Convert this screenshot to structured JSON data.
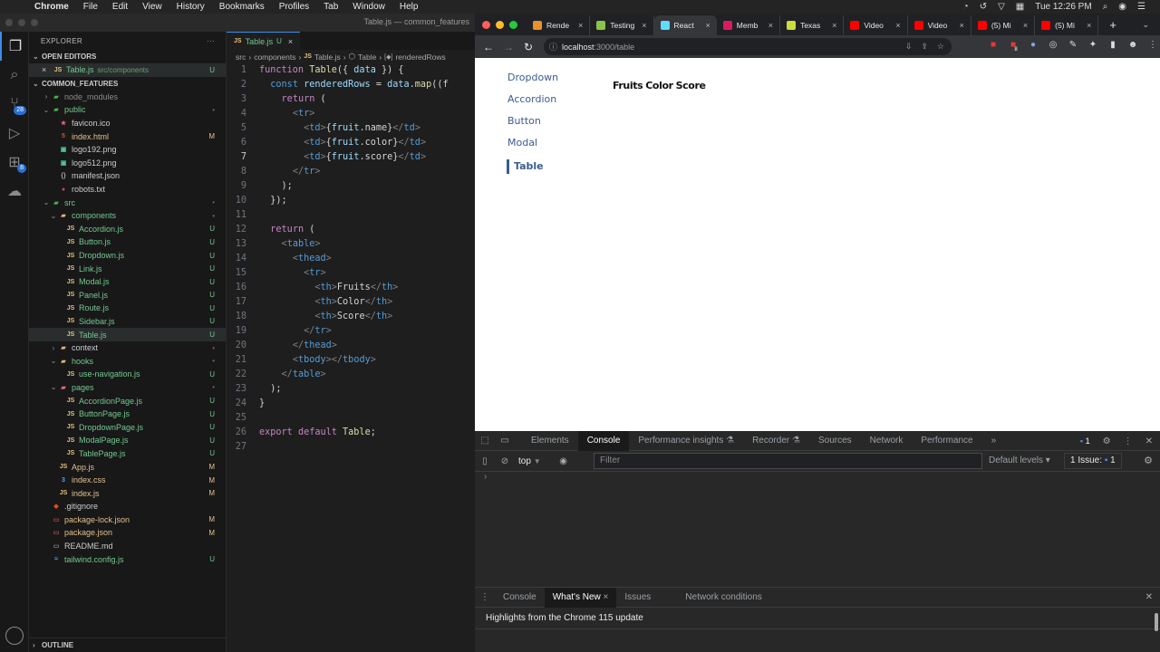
{
  "menubar": {
    "app": "Chrome",
    "items": [
      "File",
      "Edit",
      "View",
      "History",
      "Bookmarks",
      "Profiles",
      "Tab",
      "Window",
      "Help"
    ],
    "clock": "Tue 12:26 PM"
  },
  "vscode": {
    "window_title": "Table.js — common_features",
    "activity_badges": {
      "source_control": "28",
      "extensions": "8"
    },
    "explorer_label": "EXPLORER",
    "open_editors_label": "OPEN EDITORS",
    "open_editor": {
      "name": "Table.js",
      "path": "src/components",
      "status": "U"
    },
    "project_label": "COMMON_FEATURES",
    "outline_label": "OUTLINE",
    "tree": [
      {
        "name": "node_modules",
        "type": "folder",
        "depth": 0,
        "open": false,
        "color": "dim",
        "status": ""
      },
      {
        "name": "public",
        "type": "folder",
        "depth": 0,
        "open": true,
        "color": "green",
        "status": "•"
      },
      {
        "name": "favicon.ico",
        "type": "file",
        "icon": "★",
        "iconColor": "#e06c75",
        "depth": 1,
        "color": "",
        "status": ""
      },
      {
        "name": "index.html",
        "type": "file",
        "icon": "5",
        "iconColor": "#e44d26",
        "depth": 1,
        "color": "yellow",
        "status": "M"
      },
      {
        "name": "logo192.png",
        "type": "file",
        "icon": "▣",
        "iconColor": "#4ec9b0",
        "depth": 1,
        "color": "",
        "status": ""
      },
      {
        "name": "logo512.png",
        "type": "file",
        "icon": "▣",
        "iconColor": "#4ec9b0",
        "depth": 1,
        "color": "",
        "status": ""
      },
      {
        "name": "manifest.json",
        "type": "file",
        "icon": "{}",
        "iconColor": "#aaa",
        "depth": 1,
        "color": "",
        "status": ""
      },
      {
        "name": "robots.txt",
        "type": "file",
        "icon": "●",
        "iconColor": "#c74b4b",
        "depth": 1,
        "color": "",
        "status": ""
      },
      {
        "name": "src",
        "type": "folder",
        "depth": 0,
        "open": true,
        "color": "green",
        "status": "•"
      },
      {
        "name": "components",
        "type": "folder",
        "depth": 1,
        "open": true,
        "color": "green",
        "status": "•"
      },
      {
        "name": "Accordion.js",
        "type": "js",
        "depth": 2,
        "color": "green",
        "status": "U"
      },
      {
        "name": "Button.js",
        "type": "js",
        "depth": 2,
        "color": "green",
        "status": "U"
      },
      {
        "name": "Dropdown.js",
        "type": "js",
        "depth": 2,
        "color": "green",
        "status": "U"
      },
      {
        "name": "Link.js",
        "type": "js",
        "depth": 2,
        "color": "green",
        "status": "U"
      },
      {
        "name": "Modal.js",
        "type": "js",
        "depth": 2,
        "color": "green",
        "status": "U"
      },
      {
        "name": "Panel.js",
        "type": "js",
        "depth": 2,
        "color": "green",
        "status": "U"
      },
      {
        "name": "Route.js",
        "type": "js",
        "depth": 2,
        "color": "green",
        "status": "U"
      },
      {
        "name": "Sidebar.js",
        "type": "js",
        "depth": 2,
        "color": "green",
        "status": "U"
      },
      {
        "name": "Table.js",
        "type": "js",
        "depth": 2,
        "color": "green",
        "status": "U",
        "selected": true
      },
      {
        "name": "context",
        "type": "folder",
        "depth": 1,
        "open": false,
        "color": "",
        "status": "•"
      },
      {
        "name": "hooks",
        "type": "folder",
        "depth": 1,
        "open": true,
        "color": "green",
        "status": "•"
      },
      {
        "name": "use-navigation.js",
        "type": "js",
        "depth": 2,
        "color": "green",
        "status": "U"
      },
      {
        "name": "pages",
        "type": "folder",
        "depth": 1,
        "open": true,
        "color": "green",
        "status": "•"
      },
      {
        "name": "AccordionPage.js",
        "type": "js",
        "depth": 2,
        "color": "green",
        "status": "U"
      },
      {
        "name": "ButtonPage.js",
        "type": "js",
        "depth": 2,
        "color": "green",
        "status": "U"
      },
      {
        "name": "DropdownPage.js",
        "type": "js",
        "depth": 2,
        "color": "green",
        "status": "U"
      },
      {
        "name": "ModalPage.js",
        "type": "js",
        "depth": 2,
        "color": "green",
        "status": "U"
      },
      {
        "name": "TablePage.js",
        "type": "js",
        "depth": 2,
        "color": "green",
        "status": "U"
      },
      {
        "name": "App.js",
        "type": "js",
        "depth": 1,
        "color": "yellow",
        "status": "M"
      },
      {
        "name": "index.css",
        "type": "file",
        "icon": "3",
        "iconColor": "#42a5f5",
        "depth": 1,
        "color": "yellow",
        "status": "M"
      },
      {
        "name": "index.js",
        "type": "js",
        "depth": 1,
        "color": "yellow",
        "status": "M"
      },
      {
        "name": ".gitignore",
        "type": "file",
        "icon": "◆",
        "iconColor": "#e64a19",
        "depth": 0,
        "color": "",
        "status": ""
      },
      {
        "name": "package-lock.json",
        "type": "file",
        "icon": "▭",
        "iconColor": "#c74b4b",
        "depth": 0,
        "color": "yellow",
        "status": "M"
      },
      {
        "name": "package.json",
        "type": "file",
        "icon": "▭",
        "iconColor": "#c74b4b",
        "depth": 0,
        "color": "yellow",
        "status": "M"
      },
      {
        "name": "README.md",
        "type": "file",
        "icon": "▭",
        "iconColor": "#888",
        "depth": 0,
        "color": "",
        "status": ""
      },
      {
        "name": "tailwind.config.js",
        "type": "file",
        "icon": "≈",
        "iconColor": "#38bdf8",
        "depth": 0,
        "color": "green",
        "status": "U"
      }
    ],
    "editor_tab": {
      "name": "Table.js",
      "status": "U"
    },
    "breadcrumb": [
      "src",
      "components",
      "Table.js",
      "Table",
      "renderedRows"
    ],
    "current_line": 7,
    "code_lines": [
      "function Table({ data }) {",
      "  const renderedRows = data.map((f",
      "    return (",
      "      <tr>",
      "        <td>{fruit.name}</td>",
      "        <td>{fruit.color}</td>",
      "        <td>{fruit.score}</td>",
      "      </tr>",
      "    );",
      "  });",
      "",
      "  return (",
      "    <table>",
      "      <thead>",
      "        <tr>",
      "          <th>Fruits</th>",
      "          <th>Color</th>",
      "          <th>Score</th>",
      "        </tr>",
      "      </thead>",
      "      <tbody></tbody>",
      "    </table>",
      "  );",
      "}",
      "",
      "export default Table;",
      ""
    ]
  },
  "chrome": {
    "tabs": [
      {
        "title": "Rende",
        "favColor": "#e8912d",
        "active": false
      },
      {
        "title": "Testing",
        "favColor": "#8bc34a",
        "active": false
      },
      {
        "title": "React",
        "favColor": "#61dafb",
        "active": true
      },
      {
        "title": "Memb",
        "favColor": "#d81b60",
        "active": false
      },
      {
        "title": "Texas",
        "favColor": "#cddc39",
        "active": false
      },
      {
        "title": "Video",
        "favColor": "#ff0000",
        "active": false
      },
      {
        "title": "Video",
        "favColor": "#ff0000",
        "active": false
      },
      {
        "title": "(5) Mi",
        "favColor": "#ff0000",
        "active": false
      },
      {
        "title": "(5) Mi",
        "favColor": "#ff0000",
        "active": false
      }
    ],
    "url_host": "localhost",
    "url_rest": ":3000/table",
    "extension_badge": "8",
    "page": {
      "nav": [
        "Dropdown",
        "Accordion",
        "Button",
        "Modal",
        "Table"
      ],
      "active_nav": "Table",
      "table_headers": [
        "Fruits",
        "Color",
        "Score"
      ]
    },
    "devtools": {
      "tabs": [
        "Elements",
        "Console",
        "Performance insights",
        "Recorder",
        "Sources",
        "Network",
        "Performance"
      ],
      "active_tab": "Console",
      "message_count": "1",
      "context": "top",
      "filter_placeholder": "Filter",
      "levels": "Default levels",
      "issues_label": "1 Issue:",
      "issues_count": "1",
      "prompt": "›",
      "drawer_tabs": [
        "Console",
        "What's New",
        "Issues",
        "Network conditions"
      ],
      "drawer_active": "What's New",
      "whats_new_text": "Highlights from the Chrome 115 update"
    }
  }
}
